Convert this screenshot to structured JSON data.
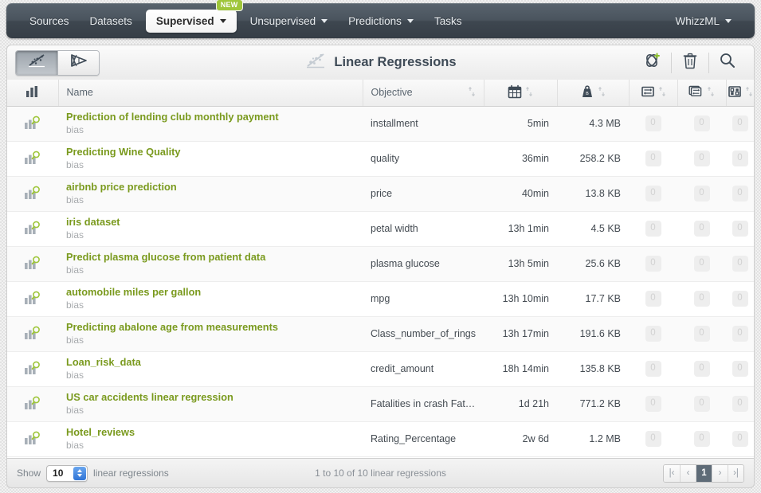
{
  "nav": {
    "items": [
      {
        "label": "Sources",
        "caret": false,
        "active": false,
        "badge": null
      },
      {
        "label": "Datasets",
        "caret": false,
        "active": false,
        "badge": null
      },
      {
        "label": "Supervised",
        "caret": true,
        "active": true,
        "badge": "NEW"
      },
      {
        "label": "Unsupervised",
        "caret": true,
        "active": false,
        "badge": null
      },
      {
        "label": "Predictions",
        "caret": true,
        "active": false,
        "badge": null
      },
      {
        "label": "Tasks",
        "caret": false,
        "active": false,
        "badge": null
      }
    ],
    "account": {
      "label": "WhizzML",
      "caret": true
    }
  },
  "toolbar": {
    "title": "Linear Regressions",
    "title_icon": "linear-regression-icon",
    "view_toggle": [
      {
        "icon": "linear-regression-icon",
        "active": true
      },
      {
        "icon": "deepnet-icon",
        "active": false
      }
    ],
    "actions": [
      {
        "icon": "add-linear-regression-icon",
        "label": ""
      },
      {
        "icon": "trash-icon",
        "label": ""
      },
      {
        "icon": "search-icon",
        "label": ""
      }
    ]
  },
  "table": {
    "columns": [
      {
        "key": "type",
        "label": "",
        "icon": "bar-chart-icon",
        "sortable": false
      },
      {
        "key": "name",
        "label": "Name",
        "icon": null,
        "sortable": false
      },
      {
        "key": "objective",
        "label": "Objective",
        "icon": null,
        "sortable": true
      },
      {
        "key": "age",
        "label": "",
        "icon": "calendar-icon",
        "sortable": true
      },
      {
        "key": "size",
        "label": "",
        "icon": "weight-icon",
        "sortable": true
      },
      {
        "key": "predictions",
        "label": "",
        "icon": "prediction-icon",
        "sortable": true
      },
      {
        "key": "batch_predictions",
        "label": "",
        "icon": "batch-prediction-icon",
        "sortable": true
      },
      {
        "key": "evaluations",
        "label": "",
        "icon": "evaluation-icon",
        "sortable": true
      }
    ],
    "rows": [
      {
        "name": "Prediction of lending club monthly payment",
        "sub": "bias",
        "objective": "installment",
        "age": "5min",
        "size": "4.3 MB",
        "predictions": "0",
        "batch_predictions": "0",
        "evaluations": "0"
      },
      {
        "name": "Predicting Wine Quality",
        "sub": "bias",
        "objective": "quality",
        "age": "36min",
        "size": "258.2 KB",
        "predictions": "0",
        "batch_predictions": "0",
        "evaluations": "0"
      },
      {
        "name": "airbnb price prediction",
        "sub": "bias",
        "objective": "price",
        "age": "40min",
        "size": "13.8 KB",
        "predictions": "0",
        "batch_predictions": "0",
        "evaluations": "0"
      },
      {
        "name": "iris dataset",
        "sub": "bias",
        "objective": "petal width",
        "age": "13h 1min",
        "size": "4.5 KB",
        "predictions": "0",
        "batch_predictions": "0",
        "evaluations": "0"
      },
      {
        "name": "Predict plasma glucose from patient data",
        "sub": "bias",
        "objective": "plasma glucose",
        "age": "13h 5min",
        "size": "25.6 KB",
        "predictions": "0",
        "batch_predictions": "0",
        "evaluations": "0"
      },
      {
        "name": "automobile miles per gallon",
        "sub": "bias",
        "objective": "mpg",
        "age": "13h 10min",
        "size": "17.7 KB",
        "predictions": "0",
        "batch_predictions": "0",
        "evaluations": "0"
      },
      {
        "name": "Predicting abalone age from measurements",
        "sub": "bias",
        "objective": "Class_number_of_rings",
        "age": "13h 17min",
        "size": "191.6 KB",
        "predictions": "0",
        "batch_predictions": "0",
        "evaluations": "0"
      },
      {
        "name": "Loan_risk_data",
        "sub": "bias",
        "objective": "credit_amount",
        "age": "18h 14min",
        "size": "135.8 KB",
        "predictions": "0",
        "batch_predictions": "0",
        "evaluations": "0"
      },
      {
        "name": "US car accidents linear regression",
        "sub": "bias",
        "objective": "Fatalities in crash Fata…",
        "age": "1d 21h",
        "size": "771.2 KB",
        "predictions": "0",
        "batch_predictions": "0",
        "evaluations": "0"
      },
      {
        "name": "Hotel_reviews",
        "sub": "bias",
        "objective": "Rating_Percentage",
        "age": "2w 6d",
        "size": "1.2 MB",
        "predictions": "0",
        "batch_predictions": "0",
        "evaluations": "0"
      }
    ]
  },
  "footer": {
    "show_label": "Show",
    "page_size": "10",
    "entity_label": "linear regressions",
    "summary": "1 to 10 of 10 linear regressions",
    "pager": {
      "first": "|‹",
      "prev": "‹",
      "current_page": "1",
      "next": "›",
      "last": "›|"
    }
  },
  "colors": {
    "accent_green": "#7a9a1e",
    "badge_green": "#9fc63b",
    "nav_dark": "#444e58",
    "title_slate": "#3f4b57"
  }
}
